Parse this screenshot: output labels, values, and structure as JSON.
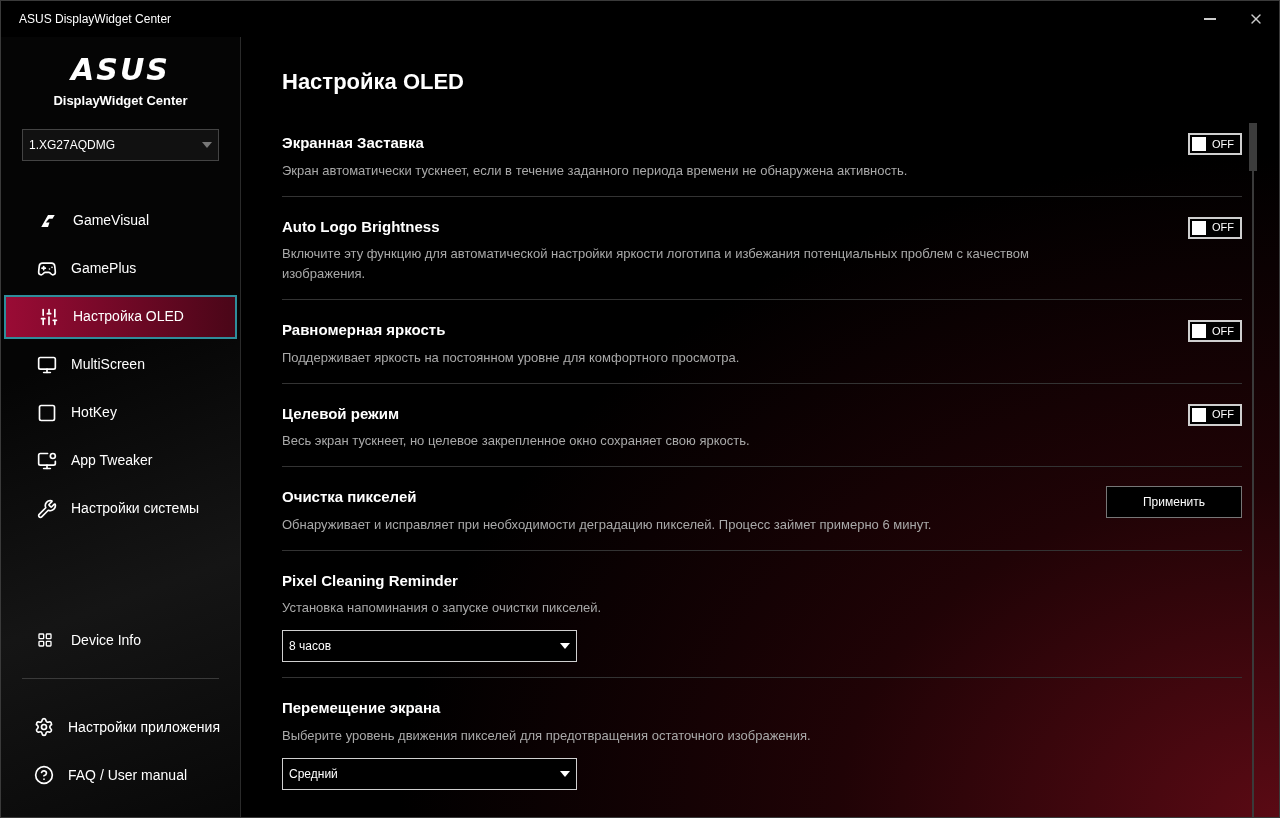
{
  "window": {
    "title": "ASUS DisplayWidget Center"
  },
  "sidebar": {
    "logo": "ASUS",
    "app_name": "DisplayWidget Center",
    "monitor_select": {
      "value": "1.XG27AQDMG"
    },
    "items": [
      {
        "label": "GameVisual",
        "selected": false
      },
      {
        "label": "GamePlus",
        "selected": false
      },
      {
        "label": "Настройка OLED",
        "selected": true
      },
      {
        "label": "MultiScreen",
        "selected": false
      },
      {
        "label": "HotKey",
        "selected": false
      },
      {
        "label": "App Tweaker",
        "selected": false
      },
      {
        "label": "Настройки системы",
        "selected": false
      }
    ],
    "device_info": {
      "label": "Device Info"
    },
    "footer_items": [
      {
        "label": "Настройки приложения"
      },
      {
        "label": "FAQ / User manual"
      }
    ]
  },
  "page": {
    "title": "Настройка OLED",
    "settings": [
      {
        "kind": "toggle",
        "title": "Экранная Заставка",
        "description": "Экран автоматически тускнеет, если в течение заданного периода времени не обнаружена активность.",
        "on": false,
        "state_label": "OFF"
      },
      {
        "kind": "toggle",
        "title": "Auto Logo Brightness",
        "description": "Включите эту функцию для автоматической настройки яркости логотипа и избежания потенциальных проблем с качеством изображения.",
        "on": false,
        "state_label": "OFF"
      },
      {
        "kind": "toggle",
        "title": "Равномерная яркость",
        "description": "Поддерживает яркость на постоянном уровне для комфортного просмотра.",
        "on": false,
        "state_label": "OFF"
      },
      {
        "kind": "toggle",
        "title": "Целевой режим",
        "description": "Весь экран тускнеет, но целевое закрепленное окно сохраняет свою яркость.",
        "on": false,
        "state_label": "OFF"
      },
      {
        "kind": "button",
        "title": "Очистка пикселей",
        "description": "Обнаруживает и исправляет при необходимости деградацию пикселей. Процесс займет примерно 6 минут.",
        "button": "Применить"
      },
      {
        "kind": "select",
        "title": "Pixel Cleaning Reminder",
        "description": "Установка напоминания о запуске очистки пикселей.",
        "value": "8 часов"
      },
      {
        "kind": "select",
        "title": "Перемещение экрана",
        "description": "Выберите уровень движения пикселей для предотвращения остаточного изображения.",
        "value": "Средний"
      }
    ]
  }
}
